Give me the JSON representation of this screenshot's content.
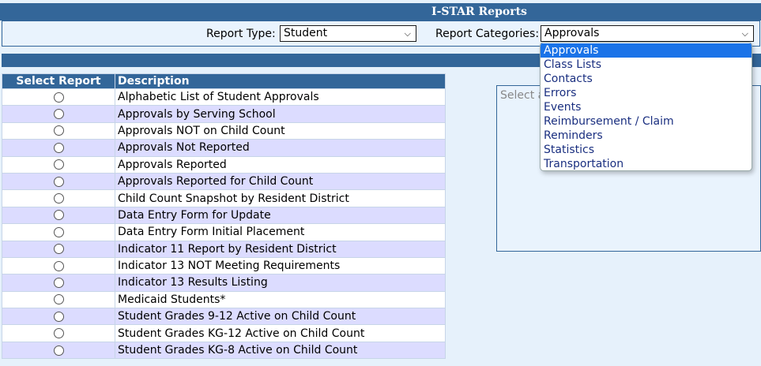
{
  "header": {
    "title": "I-STAR Reports"
  },
  "filters": {
    "report_type_label": "Report Type:",
    "report_type_value": "Student",
    "report_categories_label": "Report Categories:",
    "report_categories_value": "Approvals"
  },
  "table": {
    "col_select": "Select Report",
    "col_description": "Description",
    "rows": [
      "Alphabetic List of Student Approvals",
      "Approvals by Serving School",
      "Approvals NOT on Child Count",
      "Approvals Not Reported",
      "Approvals Reported",
      "Approvals Reported for Child Count",
      "Child Count Snapshot by Resident District",
      "Data Entry Form for Update",
      "Data Entry Form Initial Placement",
      "Indicator 11 Report by Resident District",
      "Indicator 13 NOT Meeting Requirements",
      "Indicator 13 Results Listing",
      "Medicaid Students*",
      "Student Grades 9-12 Active on Child Count",
      "Student Grades KG-12 Active on Child Count",
      "Student Grades KG-8 Active on Child Count"
    ]
  },
  "preview": {
    "placeholder": "Select a"
  },
  "dropdown": {
    "options": [
      "Approvals",
      "Class Lists",
      "Contacts",
      "Errors",
      "Events",
      "Reimbursement / Claim",
      "Reminders",
      "Statistics",
      "Transportation"
    ],
    "highlighted": "Approvals"
  },
  "colors": {
    "header_blue": "#336699",
    "highlight": "#1a73e8",
    "row_alt": "#dcdcff"
  }
}
